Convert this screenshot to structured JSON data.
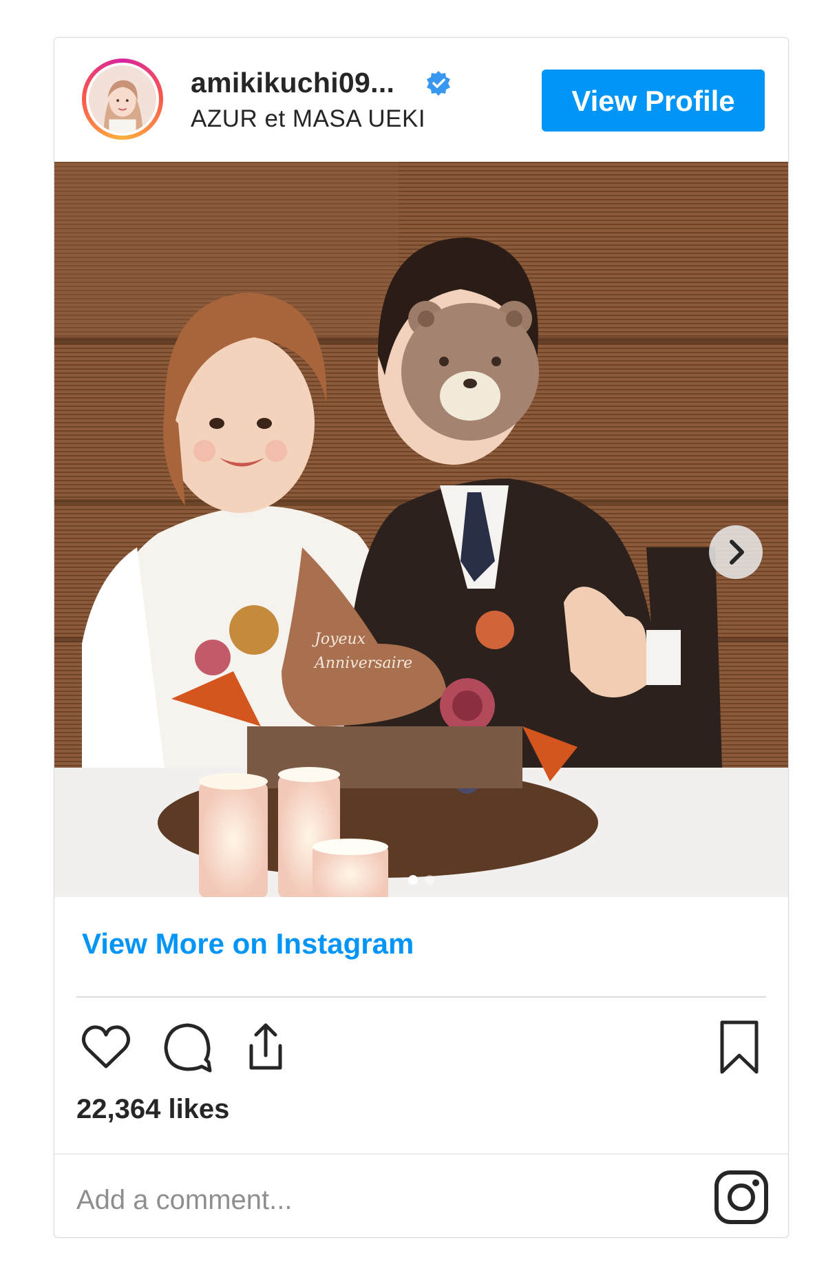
{
  "header": {
    "username": "amikikuchi09...",
    "subtitle": "AZUR et MASA UEKI",
    "verified_icon": "verified-badge-icon",
    "view_profile_label": "View Profile"
  },
  "post": {
    "carousel_dots": 2,
    "active_dot": 1,
    "cake_text_line1": "Joyeux",
    "cake_text_line2": "Anniversaire"
  },
  "links": {
    "view_more_label": "View More on Instagram"
  },
  "actions": {
    "like_icon": "heart-icon",
    "comment_icon": "comment-icon",
    "share_icon": "share-icon",
    "save_icon": "bookmark-icon"
  },
  "stats": {
    "likes_text": "22,364 likes"
  },
  "comment": {
    "placeholder": "Add a comment..."
  },
  "footer": {
    "logo_icon": "instagram-logo-icon"
  },
  "colors": {
    "accent": "#0095f6",
    "text": "#262626",
    "muted": "#8e8e8e",
    "border": "#dbdbdb"
  }
}
